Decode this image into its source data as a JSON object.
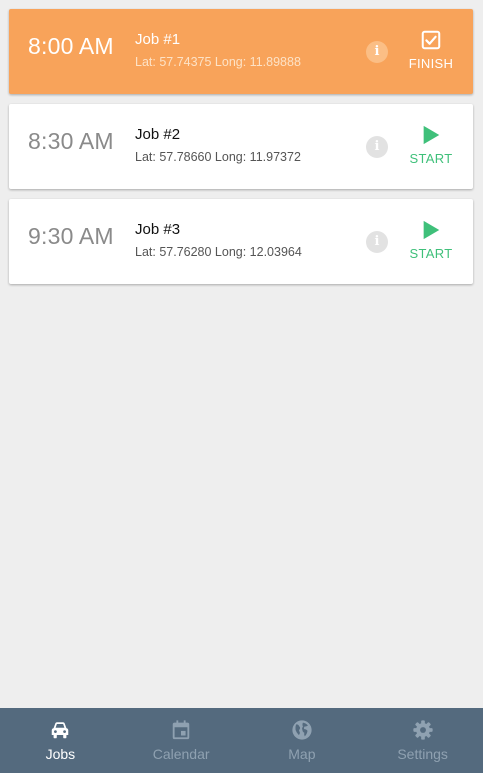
{
  "jobs": [
    {
      "time": "8:00 AM",
      "name": "Job #1",
      "coords": "Lat: 57.74375 Long: 11.89888",
      "info_icon": "info-icon",
      "action_icon": "checkbox-checked-icon",
      "action_label": "FINISH",
      "active": true
    },
    {
      "time": "8:30 AM",
      "name": "Job #2",
      "coords": "Lat: 57.78660 Long: 11.97372",
      "info_icon": "info-icon",
      "action_icon": "play-icon",
      "action_label": "START",
      "active": false
    },
    {
      "time": "9:30 AM",
      "name": "Job #3",
      "coords": "Lat: 57.76280 Long: 12.03964",
      "info_icon": "info-icon",
      "action_icon": "play-icon",
      "action_label": "START",
      "active": false
    }
  ],
  "nav": {
    "items": [
      {
        "label": "Jobs",
        "icon": "car-icon",
        "active": true
      },
      {
        "label": "Calendar",
        "icon": "calendar-icon",
        "active": false
      },
      {
        "label": "Map",
        "icon": "globe-icon",
        "active": false
      },
      {
        "label": "Settings",
        "icon": "gear-icon",
        "active": false
      }
    ]
  },
  "colors": {
    "active_card": "#f8a35a",
    "start_green": "#3fc07a",
    "nav_bg": "#546a7e",
    "nav_inactive": "#8fa1b1",
    "background": "#eeeeee"
  }
}
